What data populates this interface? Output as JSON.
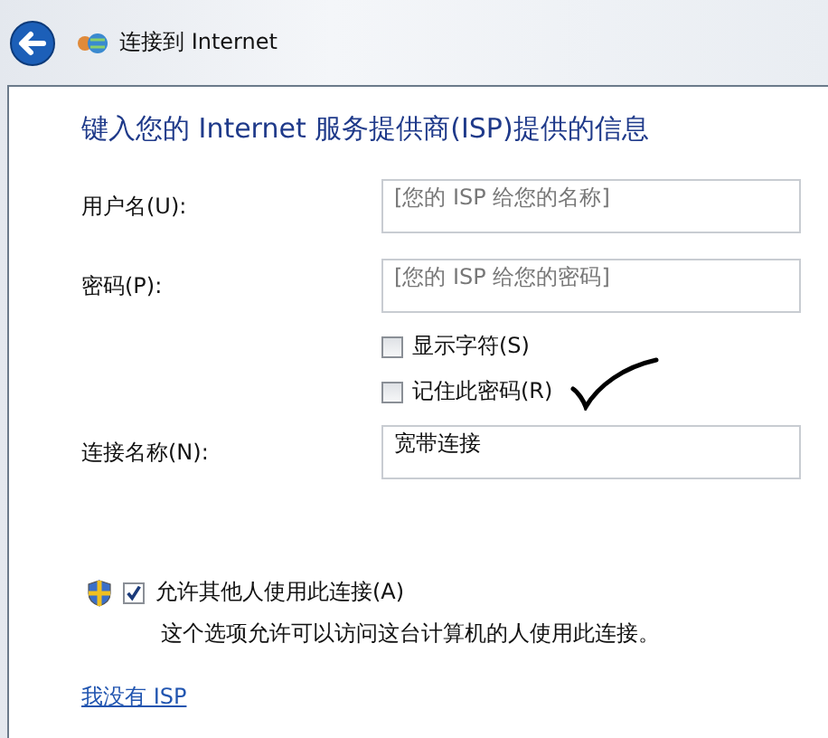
{
  "window": {
    "title": "连接到 Internet"
  },
  "heading": "键入您的 Internet 服务提供商(ISP)提供的信息",
  "fields": [
    {
      "label": "用户名(U):",
      "placeholder": "[您的 ISP 给您的名称]"
    },
    {
      "label": "密码(P):",
      "placeholder": "[您的 ISP 给您的密码]"
    }
  ],
  "password_options": [
    {
      "label": "显示字符(S)",
      "checked": false
    },
    {
      "label": "记住此密码(R)",
      "checked": false
    }
  ],
  "connection_name": {
    "label": "连接名称(N):",
    "value": "宽带连接"
  },
  "share": {
    "label": "允许其他人使用此连接(A)",
    "checked": true,
    "description": "这个选项允许可以访问这台计算机的人使用此连接。"
  },
  "link": "我没有 ISP"
}
